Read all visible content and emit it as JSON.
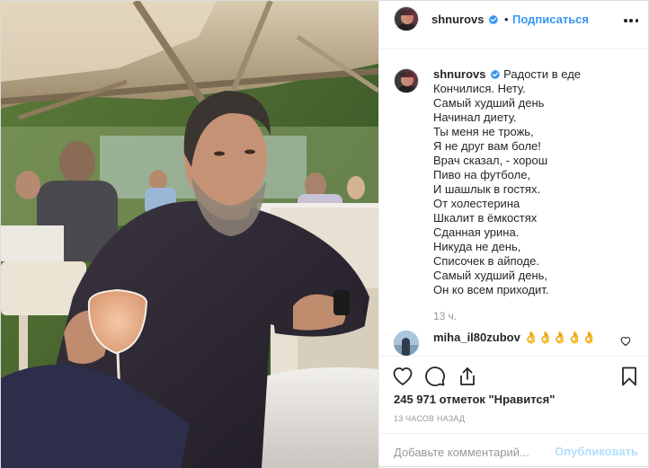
{
  "post": {
    "author": "shnurovs",
    "follow_label": "Подписаться",
    "separator": "•",
    "photo_alt": "photo",
    "verified_icon": "verified-badge-icon",
    "more_icon": "more-options-icon"
  },
  "caption": {
    "username": "shnurovs",
    "lines": [
      "Радости в еде",
      "Кончилися. Нету.",
      "Самый худший день",
      "Начинал диету.",
      "Ты меня не трожь,",
      "Я не друг вам боле!",
      "Врач сказал, - хорош",
      "Пиво на футболе,",
      "И шашлык в гостях.",
      "От холестерина",
      "Шкалит в ёмкостях",
      "Сданная урина.",
      "Никуда не день,",
      "Списочек в айподе.",
      "Самый худший день,",
      "Он ко всем приходит."
    ],
    "time": "13 ч."
  },
  "comment": {
    "username": "miha_il80zubov",
    "text": "👌👌👌👌👌"
  },
  "actions": {
    "icons": [
      "heart-icon",
      "comment-icon",
      "share-icon",
      "bookmark-icon"
    ],
    "likes": "245 971 отметок \"Нравится\"",
    "timestamp": "13 часов назад"
  },
  "add_comment": {
    "placeholder": "Добавьте комментарий...",
    "publish_label": "Опубликовать"
  },
  "colors": {
    "link_blue": "#3897f0",
    "publish_disabled": "#b2dffc",
    "muted": "#999999",
    "text": "#262626",
    "verified": "#3897f0"
  }
}
